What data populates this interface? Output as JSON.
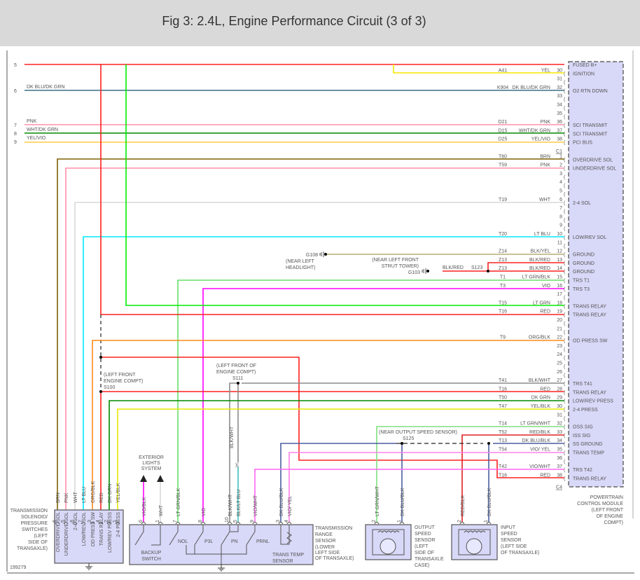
{
  "title": "Fig 3: 2.4L, Engine Performance Circuit (3 of 3)",
  "figure_number": "199279",
  "left_connector": [
    {
      "pin": "5",
      "color": ""
    },
    {
      "pin": "6",
      "color": "DK BLU/DK GRN"
    },
    {
      "pin": "7",
      "color": "PNK"
    },
    {
      "pin": "8",
      "color": "WHT/DK GRN"
    },
    {
      "pin": "9",
      "color": "YEL/VIO"
    }
  ],
  "pcm": {
    "name_lines": [
      "POWERTRAIN",
      "CONTROL MODULE",
      "(LEFT FRONT",
      "OF ENGINE",
      "COMPT)"
    ],
    "rows": [
      {
        "pin": "",
        "circuit": "",
        "color": "",
        "function": "FUSED B+"
      },
      {
        "pin": "30",
        "circuit": "A41",
        "color": "YEL",
        "function": "IGNITION"
      },
      {
        "pin": "31",
        "circuit": "",
        "color": "",
        "function": ""
      },
      {
        "pin": "32",
        "circuit": "K904",
        "color": "DK BLU/DK GRN",
        "function": "O2 RTN DOWN"
      },
      {
        "pin": "33",
        "circuit": "",
        "color": "",
        "function": ""
      },
      {
        "pin": "34",
        "circuit": "",
        "color": "",
        "function": ""
      },
      {
        "pin": "35",
        "circuit": "",
        "color": "",
        "function": ""
      },
      {
        "pin": "36",
        "circuit": "D21",
        "color": "PNK",
        "function": "SCI TRANSMIT"
      },
      {
        "pin": "37",
        "circuit": "D15",
        "color": "WHT/DK GRN",
        "function": "SCI TRANSMIT"
      },
      {
        "pin": "38",
        "circuit": "D25",
        "color": "YEL/VIO",
        "function": "PCI BUS"
      },
      {
        "connector": "C1"
      },
      {
        "pin": "1",
        "circuit": "T60",
        "color": "BRN",
        "function": "OVERDRIVE SOL"
      },
      {
        "pin": "2",
        "circuit": "T59",
        "color": "PNK",
        "function": "UNDERDRIVE SOL"
      },
      {
        "pin": "3",
        "circuit": "",
        "color": "",
        "function": ""
      },
      {
        "pin": "4",
        "circuit": "",
        "color": "",
        "function": ""
      },
      {
        "pin": "5",
        "circuit": "",
        "color": "",
        "function": ""
      },
      {
        "pin": "6",
        "circuit": "T19",
        "color": "WHT",
        "function": "2-4 SOL"
      },
      {
        "pin": "7",
        "circuit": "",
        "color": "",
        "function": ""
      },
      {
        "pin": "8",
        "circuit": "",
        "color": "",
        "function": ""
      },
      {
        "pin": "9",
        "circuit": "",
        "color": "",
        "function": ""
      },
      {
        "pin": "10",
        "circuit": "T20",
        "color": "LT BLU",
        "function": "LOW/REV SOL"
      },
      {
        "pin": "11",
        "circuit": "",
        "color": "",
        "function": ""
      },
      {
        "pin": "12",
        "circuit": "Z14",
        "color": "BLK/YEL",
        "function": "GROUND"
      },
      {
        "pin": "13",
        "circuit": "Z13",
        "color": "BLK/RED",
        "function": "GROUND"
      },
      {
        "pin": "14",
        "circuit": "Z13",
        "color": "BLK/RED",
        "function": "GROUND"
      },
      {
        "pin": "15",
        "circuit": "T1",
        "color": "LT GRN/BLK",
        "function": "TRS T1"
      },
      {
        "pin": "16",
        "circuit": "T3",
        "color": "VIO",
        "function": "TRS T3"
      },
      {
        "pin": "17",
        "circuit": "",
        "color": "",
        "function": ""
      },
      {
        "pin": "18",
        "circuit": "T15",
        "color": "LT GRN",
        "function": "TRANS RELAY"
      },
      {
        "pin": "19",
        "circuit": "T16",
        "color": "RED",
        "function": "TRANS RELAY"
      },
      {
        "pin": "20",
        "circuit": "",
        "color": "",
        "function": ""
      },
      {
        "pin": "21",
        "circuit": "",
        "color": "",
        "function": ""
      },
      {
        "pin": "22",
        "circuit": "T9",
        "color": "ORG/BLK",
        "function": "OD PRESS SW"
      },
      {
        "pin": "23",
        "circuit": "",
        "color": "",
        "function": ""
      },
      {
        "pin": "24",
        "circuit": "",
        "color": "",
        "function": ""
      },
      {
        "pin": "25",
        "circuit": "",
        "color": "",
        "function": ""
      },
      {
        "pin": "26",
        "circuit": "",
        "color": "",
        "function": ""
      },
      {
        "pin": "27",
        "circuit": "T41",
        "color": "BLK/WHT",
        "function": "TRS T41"
      },
      {
        "pin": "28",
        "circuit": "T16",
        "color": "RED",
        "function": "TRANS RELAY"
      },
      {
        "pin": "29",
        "circuit": "T50",
        "color": "DK GRN",
        "function": "LOW/REV PRESS"
      },
      {
        "pin": "30",
        "circuit": "T47",
        "color": "YEL/BLK",
        "function": "2-4 PRESS"
      },
      {
        "pin": "31",
        "circuit": "",
        "color": "",
        "function": ""
      },
      {
        "pin": "32",
        "circuit": "T14",
        "color": "LT GRN/WHT",
        "function": "OSS SIG"
      },
      {
        "pin": "33",
        "circuit": "T52",
        "color": "RED/BLK",
        "function": "ISS SIG"
      },
      {
        "pin": "34",
        "circuit": "T13",
        "color": "DK BLU/BLK",
        "function": "SS GROUND"
      },
      {
        "pin": "35",
        "circuit": "T54",
        "color": "VIO/ YEL",
        "function": "TRANS TEMP"
      },
      {
        "pin": "36",
        "circuit": "",
        "color": "",
        "function": ""
      },
      {
        "pin": "37",
        "circuit": "T42",
        "color": "VIO/WHT",
        "function": "TRS T42"
      },
      {
        "pin": "38",
        "circuit": "T16",
        "color": "RED",
        "function": "TRANS RELAY"
      },
      {
        "connector": "C4"
      }
    ]
  },
  "grounds": {
    "g108": {
      "id": "G108",
      "loc": [
        "(NEAR LEFT",
        "HEADLIGHT)"
      ]
    },
    "g103": {
      "id": "G103",
      "loc": [
        "(NEAR LEFT FRONT",
        "STRUT TOWER)"
      ],
      "wire": "BLK/RED"
    }
  },
  "splices": {
    "s123": "S123",
    "s100": {
      "id": "S100",
      "loc": [
        "(LEFT FRONT",
        "ENGINE COMPT)"
      ]
    },
    "s111": {
      "id": "S111",
      "loc": [
        "(LEFT FRONT OF",
        "ENGINE COMPT)"
      ]
    },
    "s125": {
      "id": "S125",
      "loc": "(NEAR OUTPUT SPEED SENSOR)"
    }
  },
  "solenoid_pack": {
    "name_lines": [
      "TRANSMISSION",
      "SOLENOID/",
      "PRESSURE",
      "SWITCHES",
      "(LEFT",
      "SIDE OF",
      "TRANSAXLE)"
    ],
    "pins": [
      {
        "pin": "6",
        "color": "BRN",
        "function": "OVERDRIVE SOL"
      },
      {
        "pin": "5",
        "color": "PNK",
        "function": "UNDERDRIVE SOL"
      },
      {
        "pin": "8",
        "color": "WHT",
        "function": "2-4 SOL"
      },
      {
        "pin": "7",
        "color": "LT BLU",
        "function": "LOW/REV SOL"
      },
      {
        "pin": "3",
        "color": "ORG/BLK",
        "function": "OD PRESS SW"
      },
      {
        "pin": "4",
        "color": "RED",
        "function": "TRANS RELAY"
      },
      {
        "pin": "2",
        "color": "DK GRN",
        "function": "LOW/REV PRESS"
      },
      {
        "pin": "1",
        "color": "YEL/BLK",
        "function": "2-4 PRESS"
      }
    ]
  },
  "exterior_lights": [
    "EXTERIOR",
    "LIGHTS",
    "SYSTEM"
  ],
  "trs": {
    "name_lines": [
      "TRANSMISSION",
      "RANGE",
      "SENSOR",
      "(LOWER",
      "LEFT SIDE",
      "OF TRANSAXLE)"
    ],
    "pins": [
      {
        "pin": "6",
        "color": "VIO/BLK"
      },
      {
        "pin": "1",
        "color": "WHT"
      },
      {
        "pin": "7",
        "color": "LT GRN/BLK"
      },
      {
        "pin": "8",
        "color": "VIO"
      },
      {
        "pin": "10",
        "color": "BLK/WHT"
      },
      {
        "pin": "5",
        "color": "BLK/LT BLU"
      },
      {
        "pin": "9",
        "color": "VIO/WHT"
      },
      {
        "pin": "3",
        "color": "DK BLU/BLK"
      },
      {
        "pin": "4",
        "color": "VIO/ YEL"
      }
    ],
    "switches": [
      "NOL",
      "P3L",
      "PN",
      "PRNL"
    ],
    "backup": [
      "BACKUP",
      "SWITCH"
    ],
    "temp": [
      "TRANS TEMP",
      "SENSOR"
    ]
  },
  "oss": {
    "name_lines": [
      "OUTPUT",
      "SPEED",
      "SENSOR",
      "(LEFT",
      "SIDE OF",
      "TRANSAXLE",
      "CASE)"
    ],
    "pins": [
      {
        "pin": "2",
        "color": "LT GRN/WHT"
      },
      {
        "pin": "1",
        "color": "DK BLU/BLK"
      }
    ]
  },
  "iss": {
    "name_lines": [
      "INPUT",
      "SPEED",
      "SENSOR",
      "(LEFT SIDE",
      "OF TRANSAXLE)"
    ],
    "pins": [
      {
        "pin": "2",
        "color": "RED/BLK"
      },
      {
        "pin": "1",
        "color": "DK BLU/BLK"
      }
    ]
  }
}
